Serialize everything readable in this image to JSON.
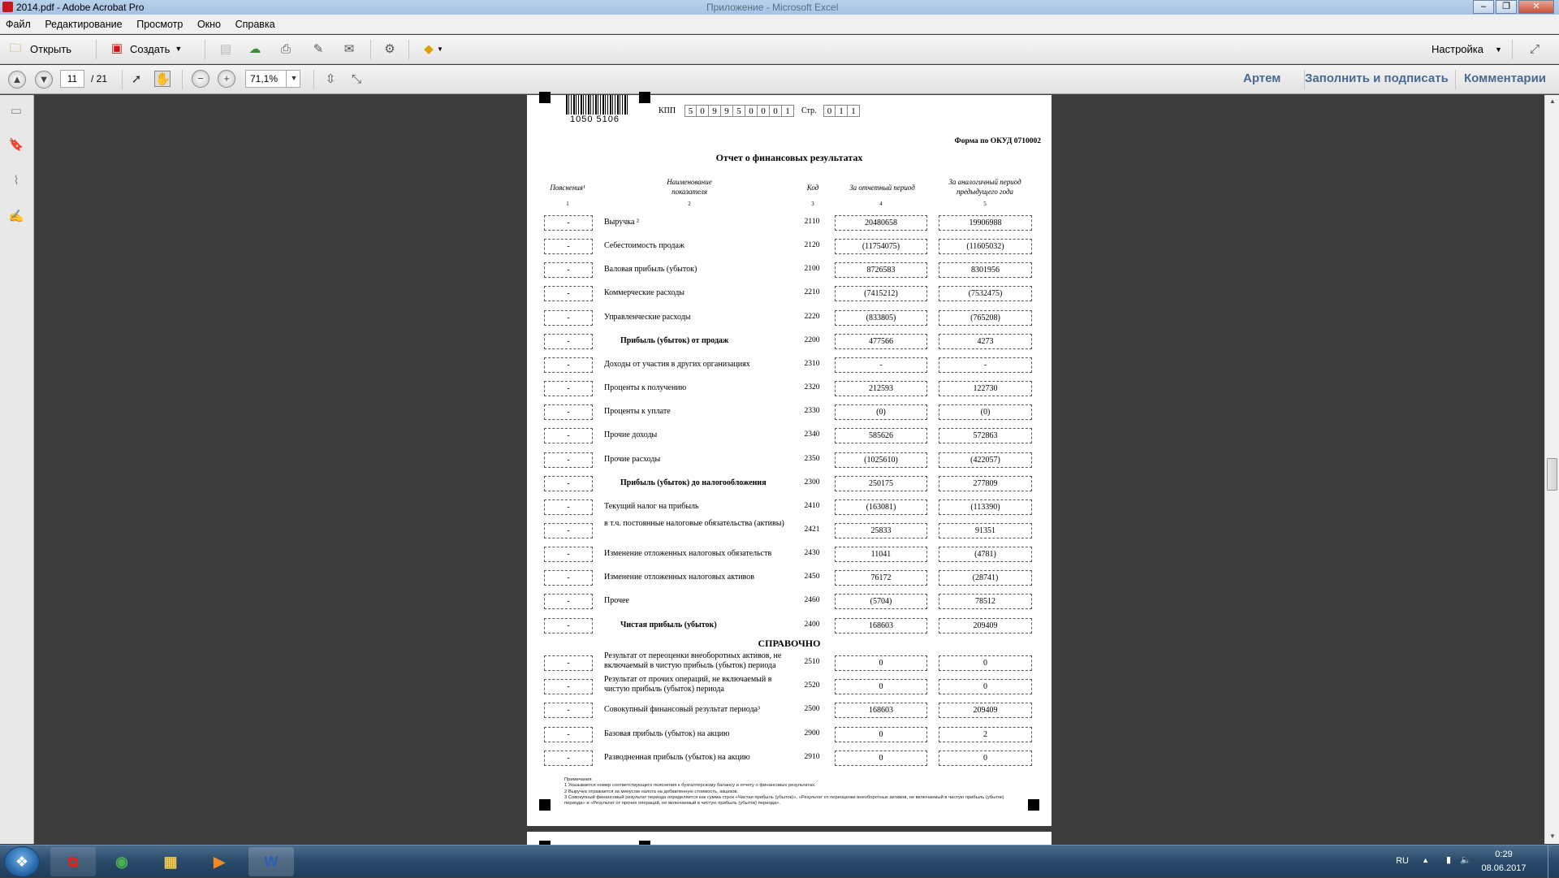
{
  "window": {
    "title": "2014.pdf - Adobe Acrobat Pro",
    "background_title": "Приложение - Microsoft Excel"
  },
  "menu": [
    "Файл",
    "Редактирование",
    "Просмотр",
    "Окно",
    "Справка"
  ],
  "toolbar1": {
    "open_label": "Открыть",
    "create_label": "Создать",
    "customize_label": "Настройка"
  },
  "toolbar2": {
    "page_current": "11",
    "page_total": "/ 21",
    "zoom": "71,1%",
    "links": [
      "Артем",
      "Заполнить и подписать",
      "Комментарии"
    ]
  },
  "doc": {
    "barcode_number": "1050 5106",
    "kpp_label": "КПП",
    "kpp_digits": [
      "5",
      "0",
      "9",
      "9",
      "5",
      "0",
      "0",
      "0",
      "1"
    ],
    "page_label": "Стр.",
    "page_digits": [
      "0",
      "1",
      "1"
    ],
    "form_code": "Форма по ОКУД 0710002",
    "title": "Отчет о финансовых результатах",
    "headers": {
      "c1": "Пояснения¹",
      "c2": "Наименование показателя",
      "c3": "Код",
      "c4": "За отчетный период",
      "c5": "За аналогичный период предыдущего года",
      "n1": "1",
      "n2": "2",
      "n3": "3",
      "n4": "4",
      "n5": "5"
    },
    "rows": [
      {
        "p": "-",
        "name": "Выручка ²",
        "code": "2110",
        "cur": "20480658",
        "prev": "19906988"
      },
      {
        "p": "-",
        "name": "Себестоимость продаж",
        "code": "2120",
        "cur": "(11754075)",
        "prev": "(11605032)"
      },
      {
        "p": "-",
        "name": "Валовая прибыль (убыток)",
        "code": "2100",
        "cur": "8726583",
        "prev": "8301956"
      },
      {
        "p": "-",
        "name": "Коммерческие расходы",
        "code": "2210",
        "cur": "(7415212)",
        "prev": "(7532475)"
      },
      {
        "p": "-",
        "name": "Управленческие расходы",
        "code": "2220",
        "cur": "(833805)",
        "prev": "(765208)"
      },
      {
        "p": "-",
        "name": "Прибыль (убыток) от продаж",
        "code": "2200",
        "cur": "477566",
        "prev": "4273"
      },
      {
        "p": "-",
        "name": "Доходы от участия в других организациях",
        "code": "2310",
        "cur": "-",
        "prev": "-"
      },
      {
        "p": "-",
        "name": "Проценты к получению",
        "code": "2320",
        "cur": "212593",
        "prev": "122730"
      },
      {
        "p": "-",
        "name": "Проценты к уплате",
        "code": "2330",
        "cur": "(0)",
        "prev": "(0)"
      },
      {
        "p": "-",
        "name": "Прочие доходы",
        "code": "2340",
        "cur": "585626",
        "prev": "572863"
      },
      {
        "p": "-",
        "name": "Прочие расходы",
        "code": "2350",
        "cur": "(1025610)",
        "prev": "(422057)"
      },
      {
        "p": "-",
        "name": "Прибыль (убыток) до налогообложения",
        "code": "2300",
        "cur": "250175",
        "prev": "277809"
      },
      {
        "p": "-",
        "name": "Текущий налог на прибыль",
        "code": "2410",
        "cur": "(163081)",
        "prev": "(113390)"
      },
      {
        "p": "-",
        "name": "в т.ч. постоянные налоговые обязательства (активы)",
        "code": "2421",
        "cur": "25833",
        "prev": "91351"
      },
      {
        "p": "-",
        "name": "Изменение отложенных налоговых обязательств",
        "code": "2430",
        "cur": "11041",
        "prev": "(4781)"
      },
      {
        "p": "-",
        "name": "Изменение отложенных налоговых активов",
        "code": "2450",
        "cur": "76172",
        "prev": "(28741)"
      },
      {
        "p": "-",
        "name": "Прочее",
        "code": "2460",
        "cur": "(5704)",
        "prev": "78512"
      },
      {
        "p": "-",
        "name": "Чистая прибыль (убыток)",
        "code": "2400",
        "cur": "168603",
        "prev": "209409"
      }
    ],
    "reference_title": "СПРАВОЧНО",
    "ref_rows": [
      {
        "p": "-",
        "name": "Результат от переоценки внеоборотных активов, не включаемый в чистую прибыль (убыток) периода",
        "code": "2510",
        "cur": "0",
        "prev": "0"
      },
      {
        "p": "-",
        "name": "Результат от прочих операций, не включаемый в чистую прибыль (убыток) периода",
        "code": "2520",
        "cur": "0",
        "prev": "0"
      },
      {
        "p": "-",
        "name": "Совокупный финансовый результат периода³",
        "code": "2500",
        "cur": "168603",
        "prev": "209409"
      },
      {
        "p": "-",
        "name": "Базовая прибыль (убыток) на акцию",
        "code": "2900",
        "cur": "0",
        "prev": "2"
      },
      {
        "p": "-",
        "name": "Разводненная прибыль (убыток) на акцию",
        "code": "2910",
        "cur": "0",
        "prev": "0"
      }
    ],
    "notes": [
      "Примечания",
      "1 Указывается номер соответствующего пояснения к бухгалтерскому балансу и отчету о финансовых результатах.",
      "2 Выручка отражается за минусом налога на добавленную стоимость, акцизов.",
      "3 Совокупный финансовый результат периода определяется как сумма строк «Чистая прибыль (убыток)», «Результат от переоценки внеоборотных активов, не включаемый в чистую прибыль (убыток) периода» и «Результат от прочих операций, не включаемый в чистую прибыль (убыток) периода»."
    ]
  },
  "tray": {
    "lang": "RU",
    "time": "0:29",
    "date": "08.06.2017"
  }
}
